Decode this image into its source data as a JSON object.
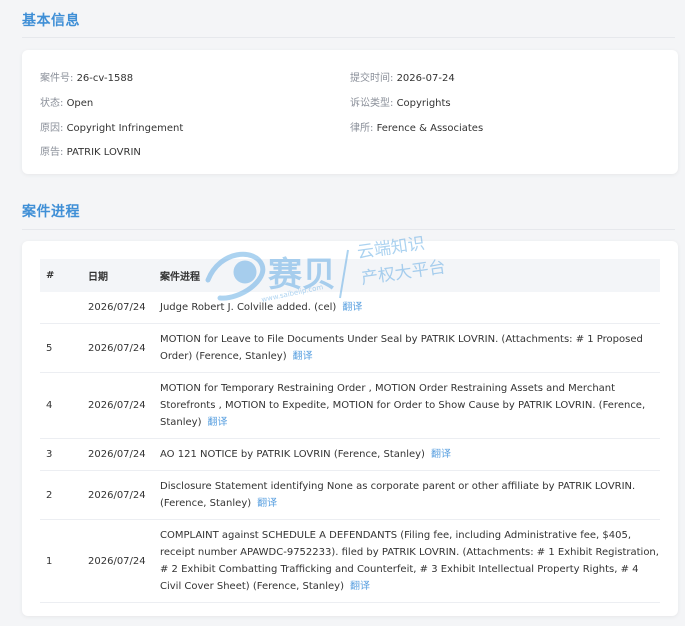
{
  "basic_info": {
    "title": "基本信息",
    "case_number_label": "案件号: ",
    "case_number": "26-cv-1588",
    "filed_time_label": "提交时间: ",
    "filed_time": "2026-07-24",
    "status_label": "状态: ",
    "status": "Open",
    "case_type_label": "诉讼类型: ",
    "case_type": "Copyrights",
    "cause_label": "原因: ",
    "cause": "Copyright Infringement",
    "law_firm_label": "律所: ",
    "law_firm": "Ference & Associates",
    "plaintiff_label": "原告: ",
    "plaintiff": "PATRIK LOVRIN"
  },
  "progress": {
    "title": "案件进程",
    "headers": {
      "num": "#",
      "date": "日期",
      "detail": "案件进程"
    },
    "translate_label": "翻译",
    "rows": [
      {
        "num": "",
        "date": "2026/07/24",
        "text": "Judge Robert J. Colville added. (cel)"
      },
      {
        "num": "5",
        "date": "2026/07/24",
        "text": "MOTION for Leave to File Documents Under Seal by PATRIK LOVRIN. (Attachments: # 1 Proposed Order) (Ference, Stanley)"
      },
      {
        "num": "4",
        "date": "2026/07/24",
        "text": "MOTION for Temporary Restraining Order , MOTION Order Restraining Assets and Merchant Storefronts , MOTION to Expedite, MOTION for Order to Show Cause by PATRIK LOVRIN. (Ference, Stanley)"
      },
      {
        "num": "3",
        "date": "2026/07/24",
        "text": "AO 121 NOTICE by PATRIK LOVRIN (Ference, Stanley)"
      },
      {
        "num": "2",
        "date": "2026/07/24",
        "text": "Disclosure Statement identifying None as corporate parent or other affiliate by PATRIK LOVRIN. (Ference, Stanley)"
      },
      {
        "num": "1",
        "date": "2026/07/24",
        "text": "COMPLAINT against SCHEDULE A DEFENDANTS (Filing fee, including Administrative fee, $405, receipt number APAWDC-9752233). filed by PATRIK LOVRIN. (Attachments: # 1 Exhibit Registration, # 2 Exhibit Combatting Trafficking and Counterfeit, # 3 Exhibit Intellectual Property Rights, # 4 Civil Cover Sheet) (Ference, Stanley)"
      }
    ]
  },
  "watermark": {
    "brand": "赛贝",
    "line1": "云端知识",
    "line2": "产权大平台",
    "url": "www.saibeiip.com",
    "color": "#4a9ee0"
  }
}
